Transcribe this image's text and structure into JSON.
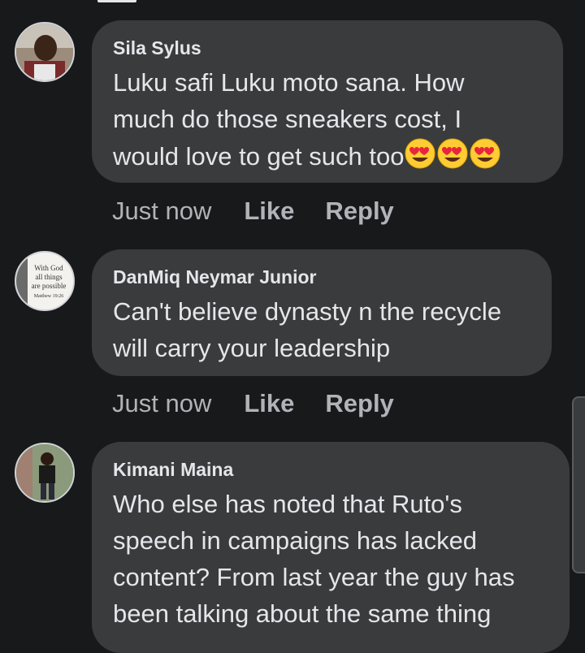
{
  "comments": [
    {
      "author": "Sila Sylus",
      "text": "Luku safi Luku moto sana. How\nmuch do those sneakers cost, I\nwould love to get such too",
      "time": "Just now",
      "like_label": "Like",
      "reply_label": "Reply",
      "emoji": [
        "smiling-face-with-heart-eyes",
        "smiling-face-with-heart-eyes",
        "smiling-face-with-heart-eyes"
      ]
    },
    {
      "author": "DanMiq Neymar Junior",
      "text": "Can't believe dynasty n the recycle\nwill carry your leadership",
      "time": "Just now",
      "like_label": "Like",
      "reply_label": "Reply",
      "avatar_text": [
        "With God",
        "all things",
        "are possible",
        "Matthew 19:26"
      ]
    },
    {
      "author": "Kimani Maina",
      "text": "Who else has noted that Ruto's\nspeech in campaigns has lacked\ncontent? From last year the guy has\nbeen talking about the same thing"
    }
  ],
  "colors": {
    "background": "#18191a",
    "bubble": "#3a3b3c",
    "text": "#e4e6eb",
    "meta": "#b0b3b8"
  }
}
